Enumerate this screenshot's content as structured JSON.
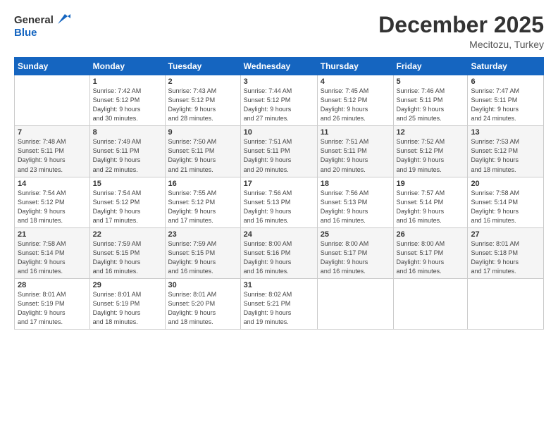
{
  "header": {
    "logo_line1": "General",
    "logo_line2": "Blue",
    "month": "December 2025",
    "location": "Mecitozu, Turkey"
  },
  "weekdays": [
    "Sunday",
    "Monday",
    "Tuesday",
    "Wednesday",
    "Thursday",
    "Friday",
    "Saturday"
  ],
  "weeks": [
    [
      {
        "day": "",
        "info": ""
      },
      {
        "day": "1",
        "info": "Sunrise: 7:42 AM\nSunset: 5:12 PM\nDaylight: 9 hours\nand 30 minutes."
      },
      {
        "day": "2",
        "info": "Sunrise: 7:43 AM\nSunset: 5:12 PM\nDaylight: 9 hours\nand 28 minutes."
      },
      {
        "day": "3",
        "info": "Sunrise: 7:44 AM\nSunset: 5:12 PM\nDaylight: 9 hours\nand 27 minutes."
      },
      {
        "day": "4",
        "info": "Sunrise: 7:45 AM\nSunset: 5:12 PM\nDaylight: 9 hours\nand 26 minutes."
      },
      {
        "day": "5",
        "info": "Sunrise: 7:46 AM\nSunset: 5:11 PM\nDaylight: 9 hours\nand 25 minutes."
      },
      {
        "day": "6",
        "info": "Sunrise: 7:47 AM\nSunset: 5:11 PM\nDaylight: 9 hours\nand 24 minutes."
      }
    ],
    [
      {
        "day": "7",
        "info": "Sunrise: 7:48 AM\nSunset: 5:11 PM\nDaylight: 9 hours\nand 23 minutes."
      },
      {
        "day": "8",
        "info": "Sunrise: 7:49 AM\nSunset: 5:11 PM\nDaylight: 9 hours\nand 22 minutes."
      },
      {
        "day": "9",
        "info": "Sunrise: 7:50 AM\nSunset: 5:11 PM\nDaylight: 9 hours\nand 21 minutes."
      },
      {
        "day": "10",
        "info": "Sunrise: 7:51 AM\nSunset: 5:11 PM\nDaylight: 9 hours\nand 20 minutes."
      },
      {
        "day": "11",
        "info": "Sunrise: 7:51 AM\nSunset: 5:11 PM\nDaylight: 9 hours\nand 20 minutes."
      },
      {
        "day": "12",
        "info": "Sunrise: 7:52 AM\nSunset: 5:12 PM\nDaylight: 9 hours\nand 19 minutes."
      },
      {
        "day": "13",
        "info": "Sunrise: 7:53 AM\nSunset: 5:12 PM\nDaylight: 9 hours\nand 18 minutes."
      }
    ],
    [
      {
        "day": "14",
        "info": "Sunrise: 7:54 AM\nSunset: 5:12 PM\nDaylight: 9 hours\nand 18 minutes."
      },
      {
        "day": "15",
        "info": "Sunrise: 7:54 AM\nSunset: 5:12 PM\nDaylight: 9 hours\nand 17 minutes."
      },
      {
        "day": "16",
        "info": "Sunrise: 7:55 AM\nSunset: 5:12 PM\nDaylight: 9 hours\nand 17 minutes."
      },
      {
        "day": "17",
        "info": "Sunrise: 7:56 AM\nSunset: 5:13 PM\nDaylight: 9 hours\nand 16 minutes."
      },
      {
        "day": "18",
        "info": "Sunrise: 7:56 AM\nSunset: 5:13 PM\nDaylight: 9 hours\nand 16 minutes."
      },
      {
        "day": "19",
        "info": "Sunrise: 7:57 AM\nSunset: 5:14 PM\nDaylight: 9 hours\nand 16 minutes."
      },
      {
        "day": "20",
        "info": "Sunrise: 7:58 AM\nSunset: 5:14 PM\nDaylight: 9 hours\nand 16 minutes."
      }
    ],
    [
      {
        "day": "21",
        "info": "Sunrise: 7:58 AM\nSunset: 5:14 PM\nDaylight: 9 hours\nand 16 minutes."
      },
      {
        "day": "22",
        "info": "Sunrise: 7:59 AM\nSunset: 5:15 PM\nDaylight: 9 hours\nand 16 minutes."
      },
      {
        "day": "23",
        "info": "Sunrise: 7:59 AM\nSunset: 5:15 PM\nDaylight: 9 hours\nand 16 minutes."
      },
      {
        "day": "24",
        "info": "Sunrise: 8:00 AM\nSunset: 5:16 PM\nDaylight: 9 hours\nand 16 minutes."
      },
      {
        "day": "25",
        "info": "Sunrise: 8:00 AM\nSunset: 5:17 PM\nDaylight: 9 hours\nand 16 minutes."
      },
      {
        "day": "26",
        "info": "Sunrise: 8:00 AM\nSunset: 5:17 PM\nDaylight: 9 hours\nand 16 minutes."
      },
      {
        "day": "27",
        "info": "Sunrise: 8:01 AM\nSunset: 5:18 PM\nDaylight: 9 hours\nand 17 minutes."
      }
    ],
    [
      {
        "day": "28",
        "info": "Sunrise: 8:01 AM\nSunset: 5:19 PM\nDaylight: 9 hours\nand 17 minutes."
      },
      {
        "day": "29",
        "info": "Sunrise: 8:01 AM\nSunset: 5:19 PM\nDaylight: 9 hours\nand 18 minutes."
      },
      {
        "day": "30",
        "info": "Sunrise: 8:01 AM\nSunset: 5:20 PM\nDaylight: 9 hours\nand 18 minutes."
      },
      {
        "day": "31",
        "info": "Sunrise: 8:02 AM\nSunset: 5:21 PM\nDaylight: 9 hours\nand 19 minutes."
      },
      {
        "day": "",
        "info": ""
      },
      {
        "day": "",
        "info": ""
      },
      {
        "day": "",
        "info": ""
      }
    ]
  ]
}
